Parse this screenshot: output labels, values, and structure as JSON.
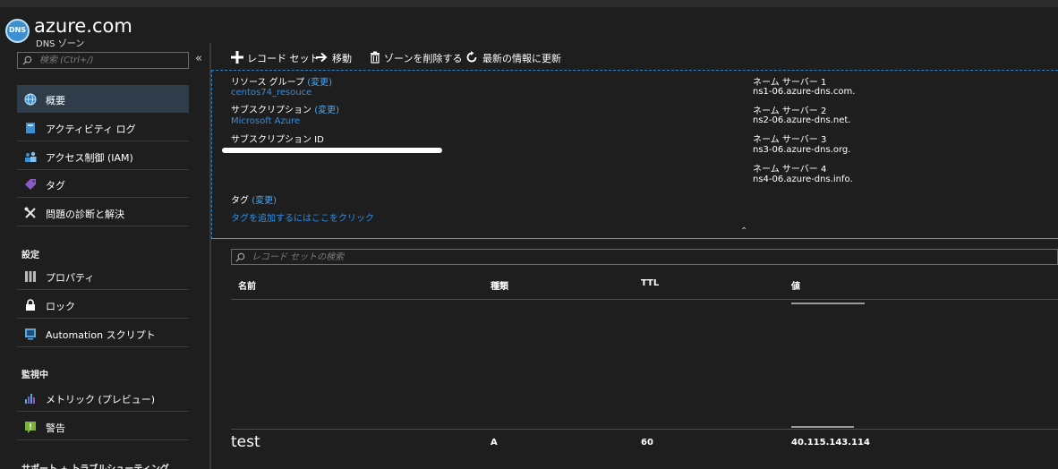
{
  "header": {
    "title": "azure.com",
    "subtitle": "DNS ゾーン",
    "logo_text": "DNS"
  },
  "sidebar": {
    "search_placeholder": "検索 (Ctrl+/)",
    "collapse_glyph": "«",
    "items": [
      {
        "label": "概要",
        "icon": "globe-icon"
      },
      {
        "label": "アクティビティ ログ",
        "icon": "activity-log-icon"
      },
      {
        "label": "アクセス制御 (IAM)",
        "icon": "users-icon"
      },
      {
        "label": "タグ",
        "icon": "tag-icon"
      },
      {
        "label": "問題の診断と解決",
        "icon": "tools-icon"
      }
    ],
    "sections": [
      {
        "title": "設定",
        "items": [
          {
            "label": "プロパティ",
            "icon": "properties-icon"
          },
          {
            "label": "ロック",
            "icon": "lock-icon"
          },
          {
            "label": "Automation スクリプト",
            "icon": "script-icon"
          }
        ]
      },
      {
        "title": "監視中",
        "items": [
          {
            "label": "メトリック (プレビュー)",
            "icon": "chart-icon"
          },
          {
            "label": "警告",
            "icon": "alert-icon"
          }
        ]
      },
      {
        "title": "サポート + トラブルシューティング",
        "items": []
      }
    ]
  },
  "toolbar": {
    "add_record_set": "レコード セット",
    "move": "移動",
    "delete_zone": "ゾーンを削除する",
    "refresh": "最新の情報に更新"
  },
  "essentials": {
    "resource_group_label": "リソース グループ",
    "resource_group_change": "(変更)",
    "resource_group_value": "centos74_resouce",
    "subscription_label": "サブスクリプション",
    "subscription_change": "(変更)",
    "subscription_value": "Microsoft Azure",
    "subscription_id_label": "サブスクリプション ID",
    "tags_label": "タグ",
    "tags_change": "(変更)",
    "tags_add_link": "タグを追加するにはここをクリック",
    "name_servers": [
      {
        "label": "ネーム サーバー 1",
        "value": "ns1-06.azure-dns.com."
      },
      {
        "label": "ネーム サーバー 2",
        "value": "ns2-06.azure-dns.net."
      },
      {
        "label": "ネーム サーバー 3",
        "value": "ns3-06.azure-dns.org."
      },
      {
        "label": "ネーム サーバー 4",
        "value": "ns4-06.azure-dns.info."
      }
    ],
    "collapse_glyph": "⌃"
  },
  "records": {
    "search_placeholder": "レコード セットの検索",
    "columns": [
      "名前",
      "種類",
      "TTL",
      "値"
    ],
    "rows": [
      {
        "name": "test",
        "type": "A",
        "ttl": "60",
        "value": "40.115.143.114"
      }
    ]
  }
}
